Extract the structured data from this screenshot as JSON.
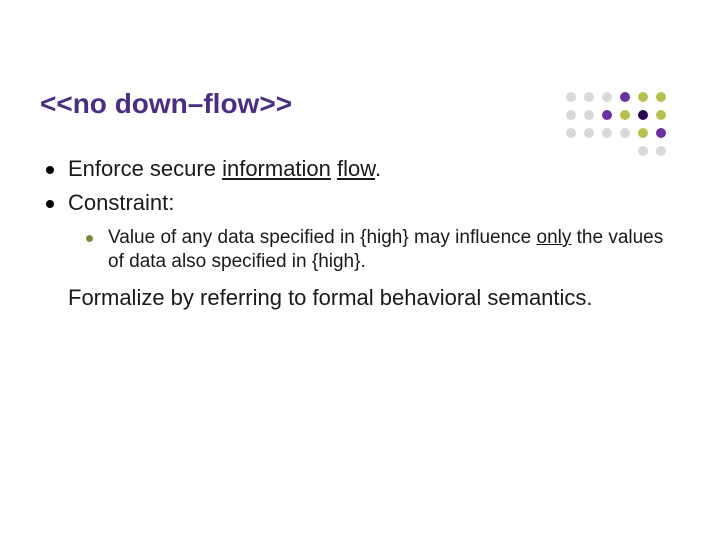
{
  "title": "<<no down–flow>>",
  "bullets": {
    "item1": {
      "pre": "Enforce secure ",
      "u1": "information",
      "mid": " ",
      "u2": "flow",
      "post": "."
    },
    "item2": "Constraint:",
    "sub1": {
      "pre": "Value of any data specified in {high} may influence ",
      "u": "only",
      "post": " the values of data also specified in {high}."
    }
  },
  "after": "Formalize by referring to formal behavioral semantics.",
  "colors": {
    "title": "#4b2e83",
    "sub_bullet": "#7c8a3f",
    "dot_dark_purple": "#2b0b4f",
    "dot_purple": "#6a2fa0",
    "dot_olive": "#b8c14e",
    "dot_gray": "#d9d9d9"
  }
}
